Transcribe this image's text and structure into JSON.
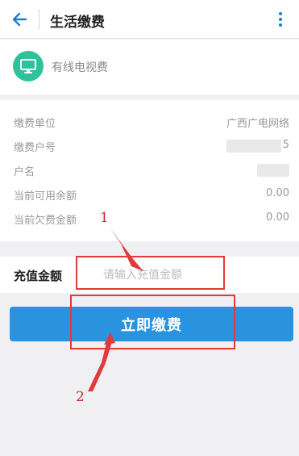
{
  "header": {
    "title": "生活缴费"
  },
  "service": {
    "name": "有线电视费",
    "icon": "tv-icon"
  },
  "info": {
    "rows": [
      {
        "label": "缴费单位",
        "value": "广西广电网络"
      },
      {
        "label": "缴费户号",
        "value": "5"
      },
      {
        "label": "户名",
        "value": ""
      },
      {
        "label": "当前可用余额",
        "value": "0.00"
      },
      {
        "label": "当前欠费金额",
        "value": "0.00"
      }
    ]
  },
  "amount": {
    "label": "充值金额",
    "placeholder": "请输入充值金额"
  },
  "pay_button": {
    "label": "立即缴费"
  },
  "annotations": {
    "step1": "1",
    "step2": "2",
    "color": "#e03a3a"
  },
  "colors": {
    "accent": "#2a93df",
    "icon_bg": "#2ec29a"
  }
}
